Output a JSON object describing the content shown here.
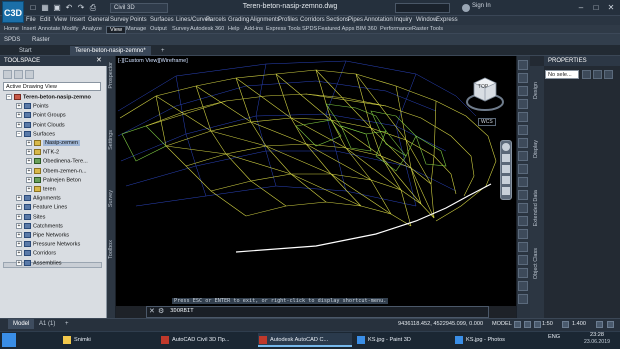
{
  "app": {
    "logo_text": "C3D",
    "workspace": "Civil 3D",
    "document_title": "Teren-beton-nasip-zemno.dwg",
    "search_placeholder": "",
    "sign_in": "Sign In"
  },
  "menu_bar": [
    "File",
    "Edit",
    "View",
    "Insert",
    "General",
    "Survey",
    "Points",
    "Surfaces",
    "Lines/Curves",
    "Parcels",
    "Grading",
    "Alignments",
    "Profiles",
    "Corridors",
    "Sections",
    "Pipes",
    "Annotation",
    "Inquiry",
    "Window",
    "Express"
  ],
  "ribbon_tabs_row1": [
    "Home",
    "Insert",
    "Annotate",
    "Modify",
    "Analyze",
    "View",
    "Manage",
    "Output",
    "Survey",
    "Autodesk 360",
    "Help",
    "Add-ins",
    "Express Tools",
    "SPDS",
    "Featured Apps",
    "BIM 360",
    "Performance",
    "Raster Tools"
  ],
  "ribbon_tabs_row0": [
    "SPDS",
    "Raster"
  ],
  "active_ribbon_tab": "View",
  "file_tabs": [
    "Start",
    "Teren-beton-nasip-zemno*"
  ],
  "toolspace": {
    "title": "TOOLSPACE",
    "view": "Active Drawing View",
    "tree": [
      {
        "label": "Teren-beton-nasip-zemno",
        "level": 0,
        "bold": true
      },
      {
        "label": "Points",
        "level": 1
      },
      {
        "label": "Point Groups",
        "level": 1
      },
      {
        "label": "Point Clouds",
        "level": 1
      },
      {
        "label": "Surfaces",
        "level": 1
      },
      {
        "label": "Nasip-zemen",
        "level": 2,
        "selected": true
      },
      {
        "label": "NTK-2",
        "level": 2
      },
      {
        "label": "Obedinena-Tere...",
        "level": 2
      },
      {
        "label": "Obem-zemen-n...",
        "level": 2
      },
      {
        "label": "Palnejen Beton",
        "level": 2
      },
      {
        "label": "teren",
        "level": 2
      },
      {
        "label": "Alignments",
        "level": 1
      },
      {
        "label": "Feature Lines",
        "level": 1
      },
      {
        "label": "Sites",
        "level": 1
      },
      {
        "label": "Catchments",
        "level": 1
      },
      {
        "label": "Pipe Networks",
        "level": 1
      },
      {
        "label": "Pressure Networks",
        "level": 1
      },
      {
        "label": "Corridors",
        "level": 1
      },
      {
        "label": "Assemblies",
        "level": 1
      }
    ],
    "side_tabs": [
      "Prospector",
      "Settings",
      "Survey",
      "Toolbox"
    ]
  },
  "viewport": {
    "label": "[-][Custom View][Wireframe]",
    "viewcube_label": "TOP",
    "wcs": "WCS"
  },
  "command": {
    "history": "Press ESC or ENTER to exit, or right-click to display shortcut-menu.",
    "prompt": "3DORBIT"
  },
  "properties": {
    "title": "PROPERTIES",
    "selection": "No sele...",
    "side_tabs": [
      "Design",
      "Display",
      "Extended Data",
      "Object Class"
    ]
  },
  "status_bar": {
    "tabs": [
      "Model",
      "A1 (1)",
      "+"
    ],
    "coordinates": "9436118.452, 4522945.099, 0.000",
    "model_space": "MODEL",
    "scale": "1:50",
    "annotation_value": "1.400"
  },
  "taskbar": {
    "items": [
      {
        "label": "Snimki",
        "icon_color": "#f2c84b"
      },
      {
        "label": "AutoCAD Civil 3D Пр...",
        "icon_color": "#c0392b"
      },
      {
        "label": "Autodesk AutoCAD C...",
        "icon_color": "#c0392b",
        "active": true
      },
      {
        "label": "KS.jpg - Paint 3D",
        "icon_color": "#3a8ee6"
      },
      {
        "label": "KS.jpg - Photos",
        "icon_color": "#3a8ee6"
      }
    ],
    "language": "ENG",
    "time": "23:28",
    "date": "23.06.2019"
  }
}
